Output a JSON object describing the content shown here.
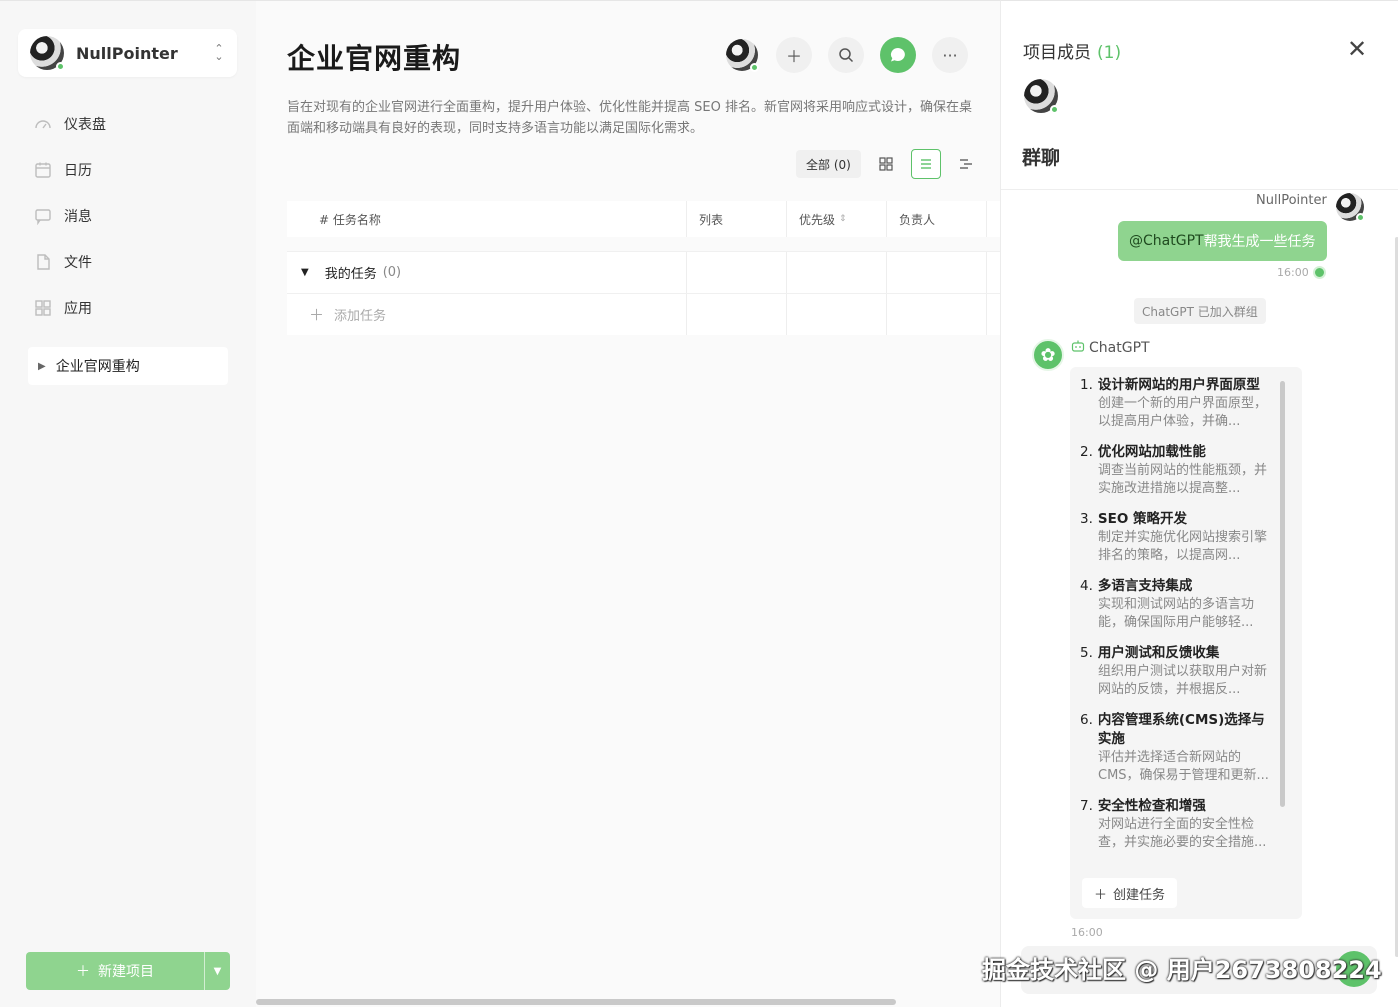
{
  "user": {
    "name": "NullPointer"
  },
  "sidebar": {
    "items": [
      {
        "label": "仪表盘",
        "icon": "dashboard-icon"
      },
      {
        "label": "日历",
        "icon": "calendar-icon"
      },
      {
        "label": "消息",
        "icon": "message-icon"
      },
      {
        "label": "文件",
        "icon": "file-icon"
      },
      {
        "label": "应用",
        "icon": "apps-icon"
      }
    ],
    "project": "企业官网重构",
    "new_project": "新建项目"
  },
  "main": {
    "title": "企业官网重构",
    "description": "旨在对现有的企业官网进行全面重构，提升用户体验、优化性能并提高 SEO 排名。新官网将采用响应式设计，确保在桌面端和移动端具有良好的表现，同时支持多语言功能以满足国际化需求。",
    "filter_all": "全部 (0)",
    "columns": [
      "# 任务名称",
      "列表",
      "优先级",
      "负责人"
    ],
    "group": {
      "name": "我的任务",
      "count": "(0)"
    },
    "add_task": "添加任务"
  },
  "panel": {
    "members_title": "项目成员",
    "members_count": "(1)",
    "group_chat": "群聊",
    "messages": {
      "me_name": "NullPointer",
      "me_mention": "@ChatGPT",
      "me_text": " 帮我生成一些任务",
      "me_time": "16:00",
      "system_note": "ChatGPT 已加入群组",
      "bot_name": "ChatGPT",
      "bot_time": "16:00",
      "create_task": "创建任务"
    },
    "tasks": [
      {
        "num": "1.",
        "title": "设计新网站的用户界面原型",
        "desc": "创建一个新的用户界面原型，以提高用户体验，并确..."
      },
      {
        "num": "2.",
        "title": "优化网站加载性能",
        "desc": "调查当前网站的性能瓶颈，并实施改进措施以提高整..."
      },
      {
        "num": "3.",
        "title": "SEO 策略开发",
        "desc": "制定并实施优化网站搜索引擎排名的策略，以提高网..."
      },
      {
        "num": "4.",
        "title": "多语言支持集成",
        "desc": "实现和测试网站的多语言功能，确保国际用户能够轻..."
      },
      {
        "num": "5.",
        "title": "用户测试和反馈收集",
        "desc": "组织用户测试以获取用户对新网站的反馈，并根据反..."
      },
      {
        "num": "6.",
        "title": "内容管理系统(CMS)选择与实施",
        "desc": "评估并选择适合新网站的 CMS，确保易于管理和更新..."
      },
      {
        "num": "7.",
        "title": "安全性检查和增强",
        "desc": "对网站进行全面的安全性检查，并实施必要的安全措施..."
      }
    ]
  },
  "watermark": "掘金技术社区 @ 用户2673808224",
  "colors": {
    "accent": "#5ec26a",
    "accent_light": "#8fd48f"
  }
}
